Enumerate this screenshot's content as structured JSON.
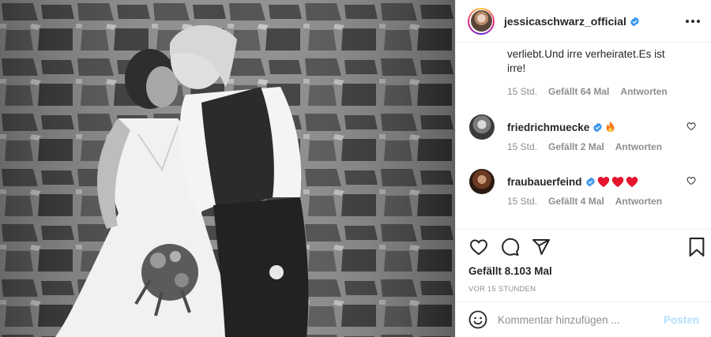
{
  "post": {
    "username": "jessicaschwarz_official",
    "verified": true,
    "caption_tail": "verliebt.Und irre verheiratet.Es ist irre!",
    "caption_meta": {
      "time": "15 Std.",
      "likes": "Gefällt 64 Mal",
      "reply": "Antworten"
    },
    "likes_text": "Gefällt 8.103 Mal",
    "posted_ago": "VOR 15 STUNDEN"
  },
  "comments": [
    {
      "user": "friedrichmuecke",
      "verified": true,
      "emoji": "fire",
      "time": "15 Std.",
      "likes": "Gefällt 2 Mal",
      "reply": "Antworten"
    },
    {
      "user": "fraubauerfeind",
      "verified": true,
      "emoji": "hearts",
      "time": "15 Std.",
      "likes": "Gefällt 4 Mal",
      "reply": "Antworten"
    }
  ],
  "composer": {
    "placeholder": "Kommentar hinzufügen ...",
    "post_label": "Posten"
  },
  "icons": [
    "more-icon",
    "verified-icon",
    "heart-icon",
    "comment-icon",
    "share-icon",
    "bookmark-icon",
    "emoji-icon",
    "fire-icon"
  ],
  "colors": {
    "verified": "#3897f0",
    "post_btn_disabled": "#b2dffc",
    "meta_grey": "#8e8e8e",
    "heart_red": "#e5142c"
  }
}
